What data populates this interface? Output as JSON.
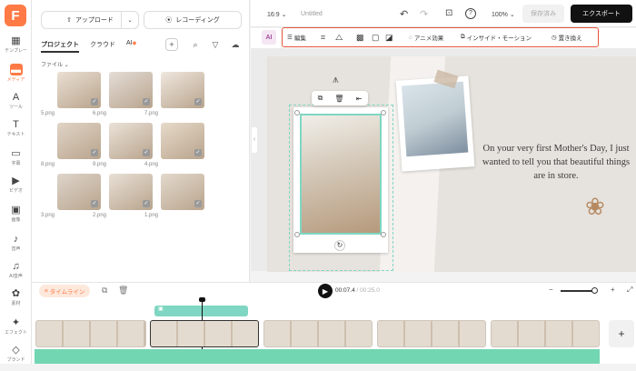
{
  "sidebar": {
    "logo": "F",
    "items": [
      {
        "label": "テンプレー",
        "icon": "template-icon",
        "glyph": "▦"
      },
      {
        "label": "メディア",
        "icon": "folder-icon",
        "glyph": "▬"
      },
      {
        "label": "ツール",
        "icon": "ai-tools-icon",
        "glyph": "A"
      },
      {
        "label": "テキスト",
        "icon": "text-icon",
        "glyph": "T"
      },
      {
        "label": "字幕",
        "icon": "subtitle-icon",
        "glyph": "▭"
      },
      {
        "label": "ビデオ",
        "icon": "video-icon",
        "glyph": "▶"
      },
      {
        "label": "画像",
        "icon": "image-icon",
        "glyph": "▣"
      },
      {
        "label": "音声",
        "icon": "music-icon",
        "glyph": "♪"
      },
      {
        "label": "AI音声",
        "icon": "ai-voice-icon",
        "glyph": "♫"
      },
      {
        "label": "素材",
        "icon": "elements-icon",
        "glyph": "✿"
      },
      {
        "label": "エフェクト",
        "icon": "effects-icon",
        "glyph": "✦"
      },
      {
        "label": "ブランド",
        "icon": "brand-icon",
        "glyph": "◇"
      }
    ]
  },
  "media_panel": {
    "upload_label": "アップロード",
    "record_label": "レコーディング",
    "tabs": [
      "プロジェクト",
      "クラウド",
      "AI"
    ],
    "filter_label": "ファイル",
    "files": [
      {
        "name": "5.png"
      },
      {
        "name": "6.png"
      },
      {
        "name": "7.png"
      },
      {
        "name": "8.png"
      },
      {
        "name": "9.png"
      },
      {
        "name": "4.png"
      },
      {
        "name": "3.png"
      },
      {
        "name": "2.png"
      },
      {
        "name": "1.png"
      }
    ]
  },
  "topbar": {
    "ratio": "16:9",
    "title": "Untitled",
    "zoom": "100%",
    "save_label": "保存済み",
    "export_label": "エクスポート"
  },
  "toolbar": {
    "ai_label": "AI",
    "edit_label": "編集",
    "animate_label": "アニメ効果",
    "inside_motion_label": "インサイド・モーション",
    "replace_label": "置き換え"
  },
  "canvas": {
    "quote": "On your very first Mother's Day, I just wanted to tell you that beautiful things are in store."
  },
  "timeline": {
    "label": "タイムライン",
    "current_time": "00:07.4",
    "total_time": "00:25.0"
  },
  "colors": {
    "accent": "#ff7a45",
    "highlight_box": "#e5543a",
    "selection": "#7fd6c2",
    "audio": "#72d6b2"
  }
}
